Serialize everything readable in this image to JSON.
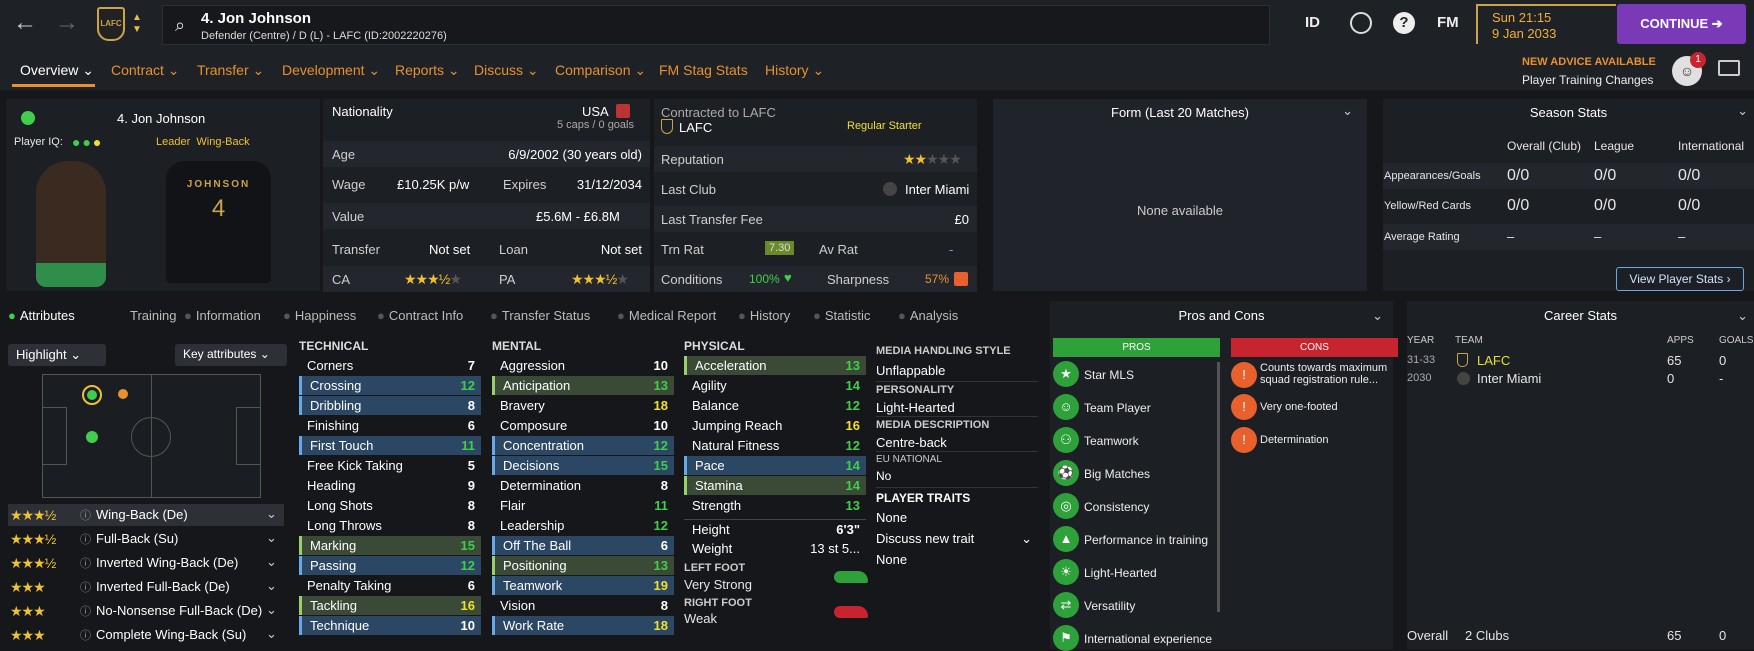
{
  "topbar": {
    "player_title": "4. Jon Johnson",
    "player_sub": "Defender (Centre) / D (L) - LAFC (ID:2002220276)",
    "id_label": "ID",
    "fm_label": "FM",
    "time": "Sun 21:15",
    "date": "9 Jan 2033",
    "continue": "CONTINUE",
    "crest_text": "LAFC"
  },
  "tabs": [
    "Overview",
    "Contract",
    "Transfer",
    "Development",
    "Reports",
    "Discuss",
    "Comparison",
    "FM Stag Stats",
    "History"
  ],
  "advice": {
    "title": "NEW ADVICE AVAILABLE",
    "text": "Player Training Changes",
    "count": "1"
  },
  "profile": {
    "name": "4. Jon Johnson",
    "iq_label": "Player IQ:",
    "leader": "Leader",
    "role": "Wing-Back",
    "shirt_name": "JOHNSON",
    "shirt_number": "4"
  },
  "info": {
    "nationality_label": "Nationality",
    "nationality": "USA",
    "caps": "5 caps / 0 goals",
    "age_label": "Age",
    "age": "6/9/2002 (30 years old)",
    "wage_label": "Wage",
    "wage": "£10.25K p/w",
    "expires_label": "Expires",
    "expires": "31/12/2034",
    "value_label": "Value",
    "value": "£5.6M - £6.8M",
    "transfer_label": "Transfer",
    "transfer": "Not set",
    "loan_label": "Loan",
    "loan": "Not set",
    "ca_label": "CA",
    "pa_label": "PA"
  },
  "contract": {
    "contracted_label": "Contracted to LAFC",
    "club": "LAFC",
    "status": "Regular Starter",
    "reputation_label": "Reputation",
    "lastclub_label": "Last Club",
    "lastclub": "Inter Miami",
    "fee_label": "Last Transfer Fee",
    "fee": "£0",
    "trn_label": "Trn Rat",
    "trn": "7.30",
    "av_label": "Av Rat",
    "av": "-",
    "conditions_label": "Conditions",
    "conditions": "100%",
    "sharpness_label": "Sharpness",
    "sharpness": "57%"
  },
  "form": {
    "title": "Form (Last 20 Matches)",
    "empty": "None available"
  },
  "season": {
    "title": "Season Stats",
    "cols": [
      "Overall (Club)",
      "League",
      "International"
    ],
    "rows": [
      {
        "label": "Appearances/Goals",
        "vals": [
          "0/0",
          "0/0",
          "0/0"
        ]
      },
      {
        "label": "Yellow/Red Cards",
        "vals": [
          "0/0",
          "0/0",
          "0/0"
        ]
      },
      {
        "label": "Average Rating",
        "vals": [
          "–",
          "–",
          "–"
        ]
      }
    ],
    "button": "View Player Stats"
  },
  "subtabs": [
    "Attributes",
    "Training",
    "Information",
    "Happiness",
    "Contract Info",
    "Transfer Status",
    "Medical Report",
    "History",
    "Statistic",
    "Analysis"
  ],
  "controls": {
    "highlight": "Highlight",
    "key": "Key attributes"
  },
  "roles": [
    {
      "name": "Wing-Back (De)",
      "stars": 3.5
    },
    {
      "name": "Full-Back (Su)",
      "stars": 3.5
    },
    {
      "name": "Inverted Wing-Back (De)",
      "stars": 3.5
    },
    {
      "name": "Inverted Full-Back (De)",
      "stars": 3
    },
    {
      "name": "No-Nonsense Full-Back (De)",
      "stars": 3
    },
    {
      "name": "Complete Wing-Back (Su)",
      "stars": 3
    }
  ],
  "technical": {
    "title": "TECHNICAL",
    "items": [
      [
        "Corners",
        "7",
        ""
      ],
      [
        "Crossing",
        "12",
        "hl"
      ],
      [
        "Dribbling",
        "8",
        "hl"
      ],
      [
        "Finishing",
        "6",
        ""
      ],
      [
        "First Touch",
        "11",
        "hl"
      ],
      [
        "Free Kick Taking",
        "5",
        ""
      ],
      [
        "Heading",
        "9",
        ""
      ],
      [
        "Long Shots",
        "8",
        ""
      ],
      [
        "Long Throws",
        "8",
        ""
      ],
      [
        "Marking",
        "15",
        "hg"
      ],
      [
        "Passing",
        "12",
        "hl"
      ],
      [
        "Penalty Taking",
        "6",
        ""
      ],
      [
        "Tackling",
        "16",
        "hg"
      ],
      [
        "Technique",
        "10",
        "hl"
      ]
    ]
  },
  "mental": {
    "title": "MENTAL",
    "items": [
      [
        "Aggression",
        "10",
        ""
      ],
      [
        "Anticipation",
        "13",
        "hg"
      ],
      [
        "Bravery",
        "18",
        ""
      ],
      [
        "Composure",
        "10",
        ""
      ],
      [
        "Concentration",
        "12",
        "hl"
      ],
      [
        "Decisions",
        "15",
        "hl"
      ],
      [
        "Determination",
        "8",
        ""
      ],
      [
        "Flair",
        "11",
        ""
      ],
      [
        "Leadership",
        "12",
        ""
      ],
      [
        "Off The Ball",
        "6",
        "hl"
      ],
      [
        "Positioning",
        "13",
        "hg"
      ],
      [
        "Teamwork",
        "19",
        "hl"
      ],
      [
        "Vision",
        "8",
        ""
      ],
      [
        "Work Rate",
        "18",
        "hl"
      ]
    ]
  },
  "physical": {
    "title": "PHYSICAL",
    "items": [
      [
        "Acceleration",
        "13",
        "hg"
      ],
      [
        "Agility",
        "14",
        ""
      ],
      [
        "Balance",
        "12",
        ""
      ],
      [
        "Jumping Reach",
        "16",
        ""
      ],
      [
        "Natural Fitness",
        "12",
        ""
      ],
      [
        "Pace",
        "14",
        "hl"
      ],
      [
        "Stamina",
        "14",
        "hg"
      ],
      [
        "Strength",
        "13",
        ""
      ]
    ],
    "height_label": "Height",
    "height": "6'3\"",
    "weight_label": "Weight",
    "weight": "13 st 5...",
    "left_label": "LEFT FOOT",
    "left": "Very Strong",
    "right_label": "RIGHT FOOT",
    "right": "Weak"
  },
  "media": {
    "style_label": "MEDIA HANDLING STYLE",
    "style": "Unflappable",
    "pers_label": "PERSONALITY",
    "pers": "Light-Hearted",
    "desc_label": "MEDIA DESCRIPTION",
    "desc": "Centre-back",
    "eu_label": "EU NATIONAL",
    "eu": "No",
    "traits_label": "PLAYER TRAITS",
    "traits": "None",
    "discuss": "Discuss new trait",
    "discuss_val": "None"
  },
  "proscons": {
    "title": "Pros and Cons",
    "pros_label": "PROS",
    "cons_label": "CONS",
    "pros": [
      "Star MLS",
      "Team Player",
      "Teamwork",
      "Big Matches",
      "Consistency",
      "Performance in training",
      "Light-Hearted",
      "Versatility",
      "International experience"
    ],
    "cons": [
      "Counts towards maximum squad registration rule...",
      "Very one-footed",
      "Determination"
    ]
  },
  "career": {
    "title": "Career Stats",
    "cols": [
      "YEAR",
      "TEAM",
      "APPS",
      "GOALS"
    ],
    "rows": [
      [
        "31-33",
        "LAFC",
        "65",
        "0"
      ],
      [
        "2030",
        "Inter Miami",
        "0",
        "-"
      ]
    ],
    "total_label": "Overall",
    "total_clubs": "2 Clubs",
    "total_apps": "65",
    "total_goals": "0"
  },
  "colors": {
    "accent": "#e8912d",
    "continue": "#7a3ab8",
    "gold": "#f2c12e"
  }
}
